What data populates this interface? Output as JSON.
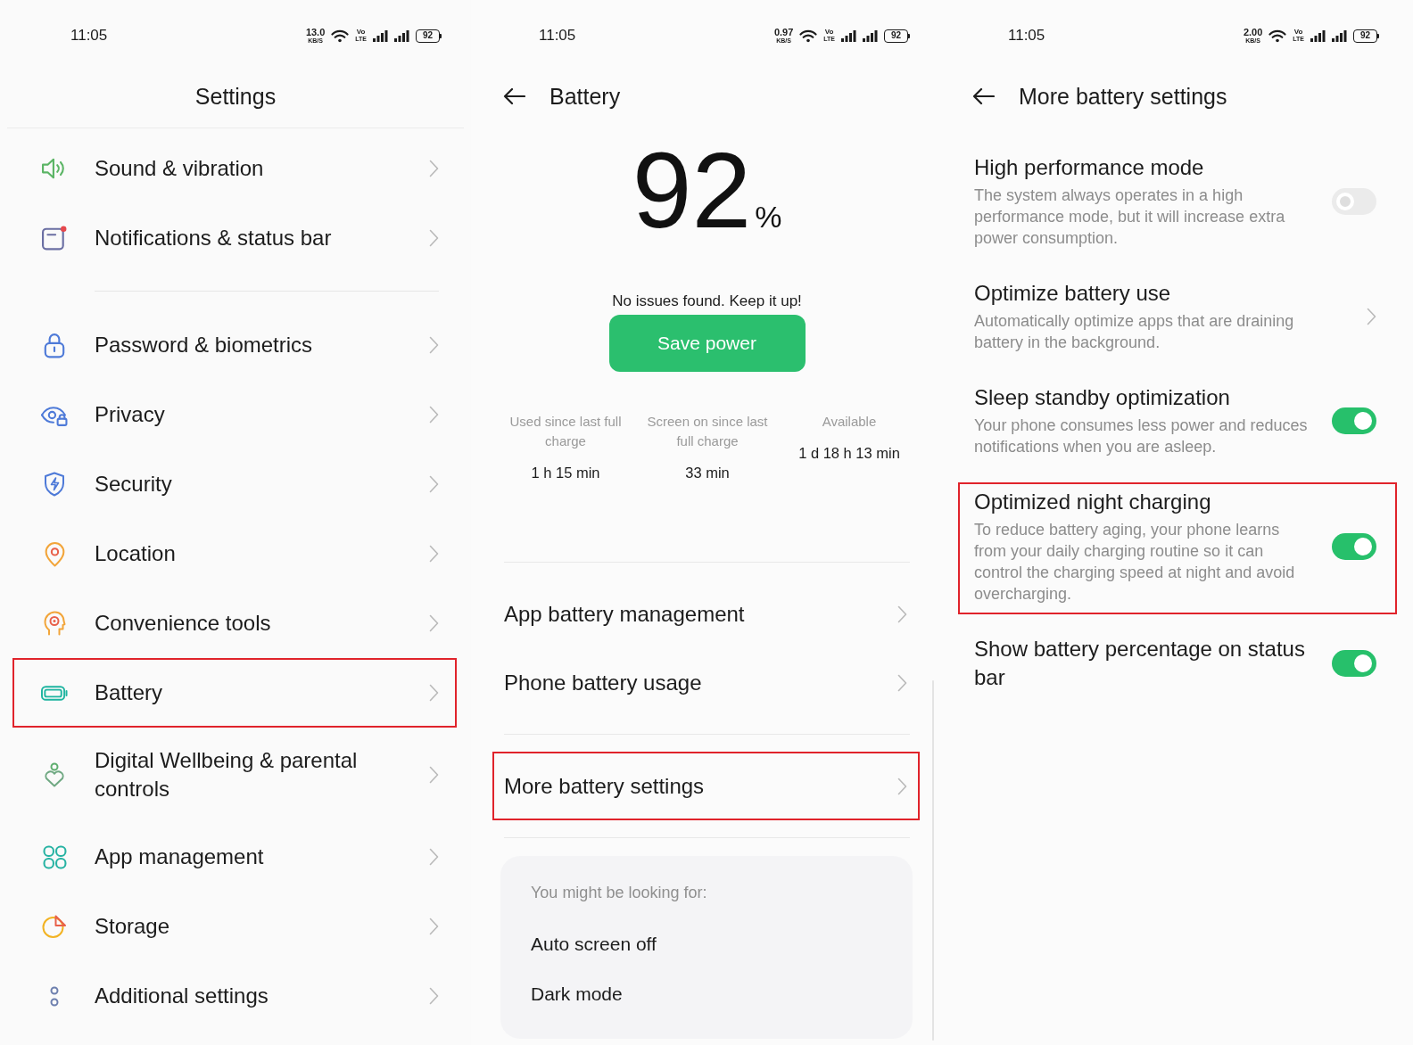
{
  "settings_screen": {
    "status_bar": {
      "time": "11:05",
      "net_speed": "13.0",
      "net_unit": "KB/S",
      "volte_top": "Vo",
      "volte_bottom": "LTE",
      "battery": "92"
    },
    "title": "Settings",
    "groups": [
      {
        "items": [
          {
            "label": "Sound & vibration",
            "highlighted": false
          },
          {
            "label": "Notifications & status bar",
            "highlighted": false
          }
        ]
      },
      {
        "items": [
          {
            "label": "Password & biometrics",
            "highlighted": false
          },
          {
            "label": "Privacy",
            "highlighted": false
          },
          {
            "label": "Security",
            "highlighted": false
          },
          {
            "label": "Location",
            "highlighted": false
          },
          {
            "label": "Convenience tools",
            "highlighted": false
          },
          {
            "label": "Battery",
            "highlighted": true
          },
          {
            "label": "Digital Wellbeing & parental controls",
            "highlighted": false
          },
          {
            "label": "App management",
            "highlighted": false
          },
          {
            "label": "Storage",
            "highlighted": false
          },
          {
            "label": "Additional settings",
            "highlighted": false
          }
        ]
      }
    ]
  },
  "battery_screen": {
    "status_bar": {
      "time": "11:05",
      "net_speed": "0.97",
      "net_unit": "KB/S",
      "volte_top": "Vo",
      "volte_bottom": "LTE",
      "battery": "92"
    },
    "title": "Battery",
    "charge": {
      "value": "92",
      "unit": "%"
    },
    "message": "No issues found. Keep it up!",
    "save_button": "Save power",
    "stats": [
      {
        "label": "Used since last full charge",
        "value": "1 h 15 min"
      },
      {
        "label": "Screen on since last full charge",
        "value": "33 min"
      },
      {
        "label": "Available",
        "value": "1 d 18 h 13 min"
      }
    ],
    "menu_groups": [
      {
        "items": [
          {
            "label": "App battery management",
            "highlighted": false
          },
          {
            "label": "Phone battery usage",
            "highlighted": false
          }
        ]
      },
      {
        "items": [
          {
            "label": "More battery settings",
            "highlighted": true
          }
        ]
      }
    ],
    "suggestions": {
      "heading": "You might be looking for:",
      "items": [
        "Auto screen off",
        "Dark mode"
      ]
    }
  },
  "more_battery_screen": {
    "status_bar": {
      "time": "11:05",
      "net_speed": "2.00",
      "net_unit": "KB/S",
      "volte_top": "Vo",
      "volte_bottom": "LTE",
      "battery": "92"
    },
    "title": "More battery settings",
    "items": [
      {
        "kind": "toggle",
        "title": "High performance mode",
        "description": "The system always operates in a high performance mode, but it will increase extra power consumption.",
        "on": false,
        "highlighted": false
      },
      {
        "kind": "link",
        "title": "Optimize battery use",
        "description": "Automatically optimize apps that are draining battery in the background.",
        "highlighted": false
      },
      {
        "kind": "toggle",
        "title": "Sleep standby optimization",
        "description": "Your phone consumes less power and reduces notifications when you are asleep.",
        "on": true,
        "highlighted": false
      },
      {
        "kind": "toggle",
        "title": "Optimized night charging",
        "description": "To reduce battery aging, your phone learns from your daily charging routine so it can control the charging speed at night and avoid overcharging.",
        "on": true,
        "highlighted": true
      },
      {
        "kind": "toggle",
        "title": "Show battery percentage on status bar",
        "on": true,
        "highlighted": false
      }
    ]
  }
}
